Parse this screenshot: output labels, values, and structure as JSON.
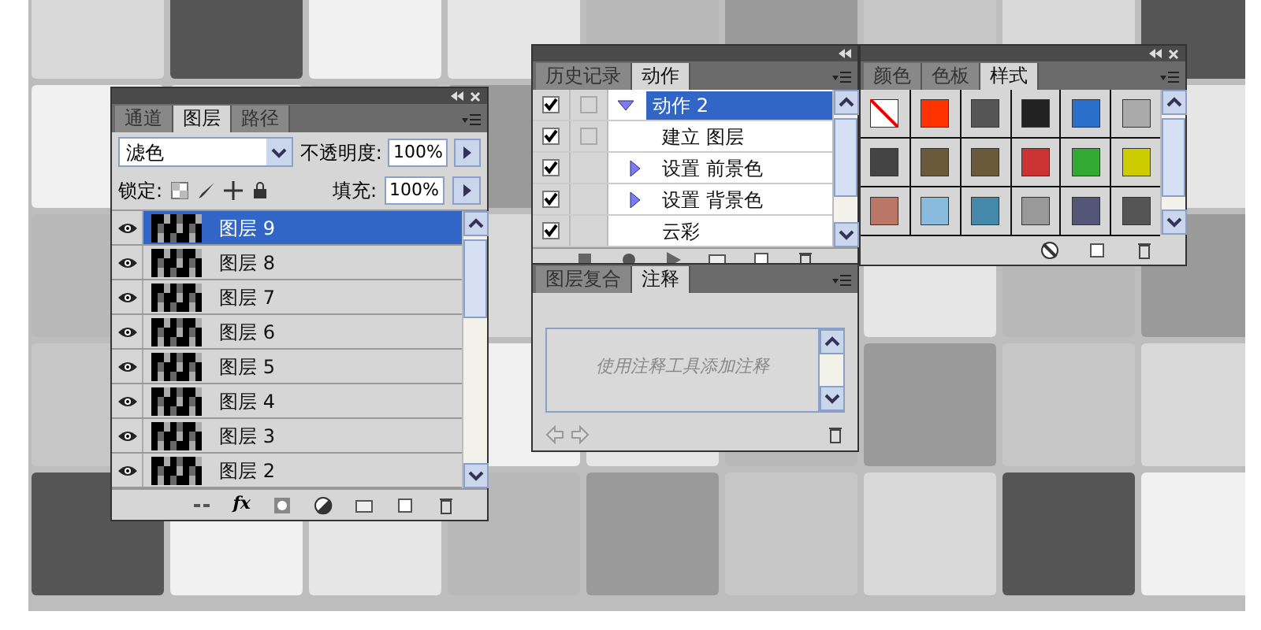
{
  "layers_panel": {
    "tabs": [
      {
        "label": "通道",
        "selected": false
      },
      {
        "label": "图层",
        "selected": true
      },
      {
        "label": "路径",
        "selected": false
      }
    ],
    "effects_label": "fx",
    "blend_mode": "滤色",
    "opacity_label": "不透明度:",
    "opacity": "100%",
    "lock_label": "锁定:",
    "fill_label": "填充:",
    "fill": "100%",
    "layers": [
      {
        "name": "图层 9",
        "visible": true,
        "selected": true
      },
      {
        "name": "图层 8",
        "visible": true,
        "selected": false
      },
      {
        "name": "图层 7",
        "visible": true,
        "selected": false
      },
      {
        "name": "图层 6",
        "visible": true,
        "selected": false
      },
      {
        "name": "图层 5",
        "visible": true,
        "selected": false
      },
      {
        "name": "图层 4",
        "visible": true,
        "selected": false
      },
      {
        "name": "图层 3",
        "visible": true,
        "selected": false
      },
      {
        "name": "图层 2",
        "visible": true,
        "selected": false
      }
    ]
  },
  "actions_panel": {
    "tabs": [
      {
        "label": "历史记录",
        "selected": false
      },
      {
        "label": "动作",
        "selected": true
      }
    ],
    "actions": [
      {
        "label": "动作 2",
        "checked": true,
        "dialog_toggle": true,
        "selected": true,
        "expanded": true,
        "children": [
          {
            "label": "建立 图层",
            "checked": true,
            "dialog_toggle": true,
            "selected": false,
            "expandable": false
          },
          {
            "label": "设置 前景色",
            "checked": true,
            "dialog_toggle": false,
            "selected": false,
            "expandable": true
          },
          {
            "label": "设置 背景色",
            "checked": true,
            "dialog_toggle": false,
            "selected": false,
            "expandable": true
          },
          {
            "label": "云彩",
            "checked": true,
            "dialog_toggle": false,
            "selected": false,
            "expandable": false
          }
        ]
      }
    ]
  },
  "styles_panel": {
    "tabs": [
      {
        "label": "颜色",
        "selected": false
      },
      {
        "label": "色板",
        "selected": false
      },
      {
        "label": "样式",
        "selected": true
      }
    ]
  },
  "notes_panel": {
    "tabs": [
      {
        "label": "图层复合",
        "selected": false
      },
      {
        "label": "注释",
        "selected": true
      }
    ],
    "placeholder": "使用注释工具添加注释"
  }
}
